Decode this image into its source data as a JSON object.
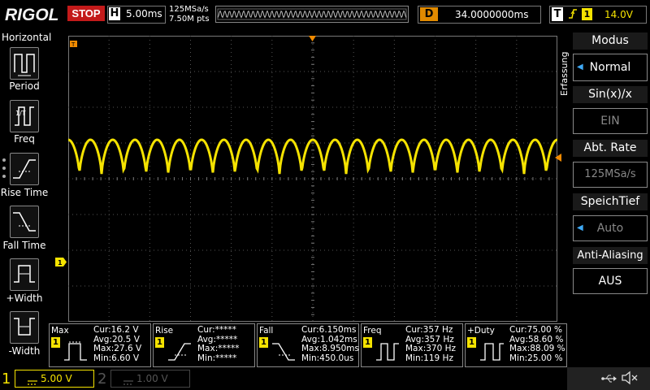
{
  "brand": "RIGOL",
  "run_status": "STOP",
  "horizontal": {
    "label": "H",
    "timebase": "5.00ms",
    "sample_rate": "125MSa/s",
    "mem_points": "7.50M pts"
  },
  "delay": {
    "label": "D",
    "value": "34.0000000ms"
  },
  "trigger": {
    "label": "T",
    "edge_icon": "rising-edge-icon",
    "channel": "1",
    "level": "14.0V"
  },
  "left_menu": {
    "title": "Horizontal",
    "items": [
      {
        "label": "Period"
      },
      {
        "label": "Freq"
      },
      {
        "label": "Rise Time"
      },
      {
        "label": "Fall Time"
      },
      {
        "label": "+Width"
      },
      {
        "label": "-Width"
      }
    ]
  },
  "right_menu": {
    "side_label": "Erfassung",
    "items": [
      {
        "title": "Modus",
        "value": "Normal"
      },
      {
        "title": "Sin(x)/x",
        "value": "EIN"
      },
      {
        "title": "Abt. Rate",
        "value": "125MSa/s"
      },
      {
        "title": "SpeichTief",
        "value": "Auto"
      },
      {
        "title": "Anti-Aliasing",
        "value": "AUS"
      }
    ]
  },
  "measurements": [
    {
      "name": "Max",
      "ch": "1",
      "cur": "Cur:16.2 V",
      "avg": "Avg:20.5 V",
      "max": "Max:27.6 V",
      "min": "Min:6.60 V"
    },
    {
      "name": "Rise",
      "ch": "1",
      "cur": "Cur:*****",
      "avg": "Avg:*****",
      "max": "Max:*****",
      "min": "Min:*****"
    },
    {
      "name": "Fall",
      "ch": "1",
      "cur": "Cur:6.150ms",
      "avg": "Avg:1.042ms",
      "max": "Max:8.950ms",
      "min": "Min:450.0us"
    },
    {
      "name": "Freq",
      "ch": "1",
      "cur": "Cur:357 Hz",
      "avg": "Avg:357 Hz",
      "max": "Max:370 Hz",
      "min": "Min:119 Hz"
    },
    {
      "name": "+Duty",
      "ch": "1",
      "cur": "Cur:75.00 %",
      "avg": "Avg:58.60 %",
      "max": "Max:88.09 %",
      "min": "Min:25.00 %"
    }
  ],
  "channels": [
    {
      "num": "1",
      "scale": "5.00 V"
    },
    {
      "num": "2",
      "scale": "1.00 V"
    }
  ],
  "trace_color": "#f5e300",
  "trigger_marker_color": "#f08a00",
  "waveform": {
    "cycles": 22
  }
}
